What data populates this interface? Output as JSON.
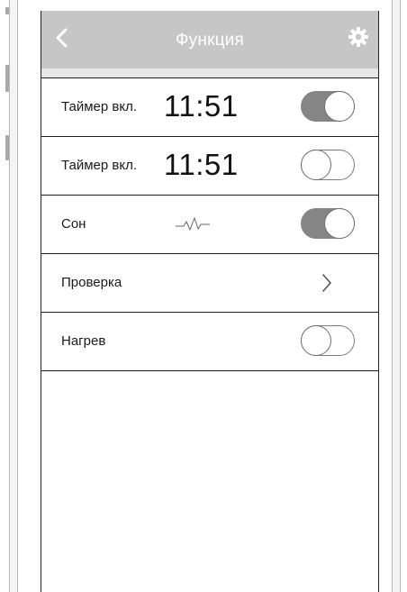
{
  "header": {
    "title": "Функция",
    "back_icon": "chevron-left-icon",
    "settings_icon": "gear-icon",
    "background": "#c6c6c6"
  },
  "rows": [
    {
      "label": "Таймер вкл.",
      "time": "11:51",
      "toggle": "on"
    },
    {
      "label": "Таймер вкл.",
      "time": "11:51",
      "toggle": "off"
    },
    {
      "label": "Сон",
      "icon": "heartbeat-wave-icon",
      "toggle": "on"
    },
    {
      "label": "Проверка",
      "icon": "chevron-right-icon"
    },
    {
      "label": "Нагрев",
      "toggle": "off"
    }
  ],
  "colors": {
    "toggle_on": "#858585",
    "toggle_off_border": "#7c7c7c"
  }
}
